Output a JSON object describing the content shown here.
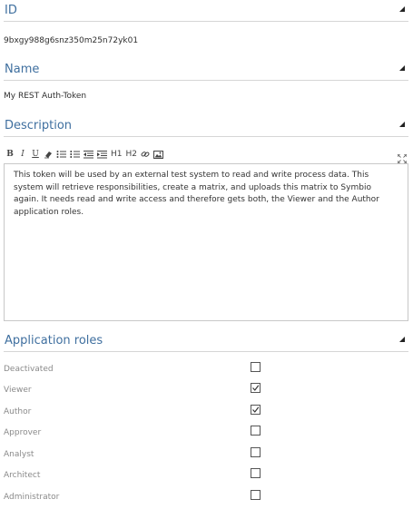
{
  "id_section": {
    "title": "ID",
    "value": "9bxgy988g6snz350m25n72yk01"
  },
  "name_section": {
    "title": "Name",
    "value": "My REST Auth-Token"
  },
  "description_section": {
    "title": "Description",
    "toolbar": {
      "bold": "B",
      "italic": "I",
      "underline": "U",
      "heading1": "H1",
      "heading2": "H2"
    },
    "text": "This token will be used by an external test system to read and write process data. This system will retrieve responsibilities, create a matrix, and uploads this matrix to Symbio again. It needs read and write access and therefore gets both, the Viewer and the Author application roles."
  },
  "roles_section": {
    "title": "Application roles",
    "roles": [
      {
        "label": "Deactivated",
        "checked": false
      },
      {
        "label": "Viewer",
        "checked": true
      },
      {
        "label": "Author",
        "checked": true
      },
      {
        "label": "Approver",
        "checked": false
      },
      {
        "label": "Analyst",
        "checked": false
      },
      {
        "label": "Architect",
        "checked": false
      },
      {
        "label": "Administrator",
        "checked": false
      }
    ]
  },
  "colors": {
    "section_title": "#3f6f9f",
    "divider": "#d6d6d6",
    "role_label": "#8a8a8a"
  }
}
